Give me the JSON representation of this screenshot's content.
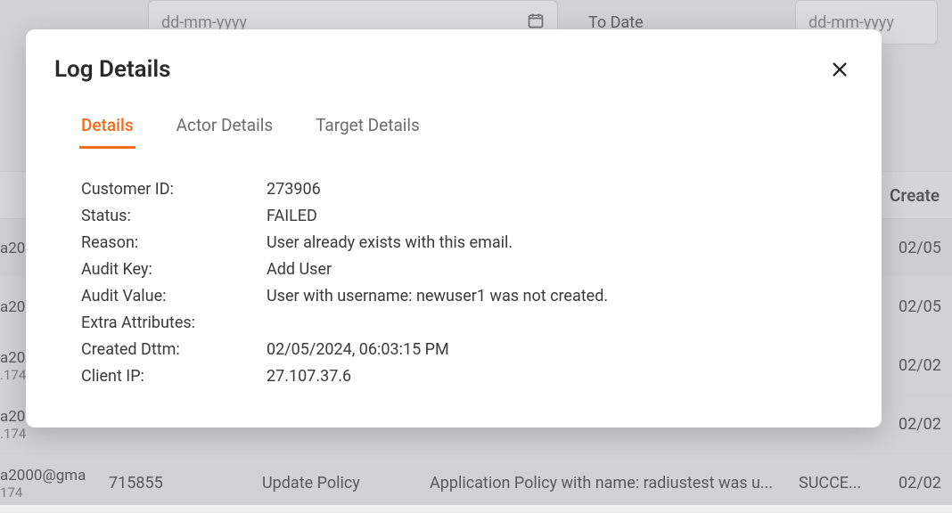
{
  "bg": {
    "from_placeholder": "dd-mm-yyyy",
    "to_label": "To Date",
    "to_placeholder": "dd-mm-yyyy",
    "header": {
      "created": "Create"
    },
    "rows": [
      {
        "email_l1": "a20",
        "email_l2": "",
        "id": "",
        "key": "",
        "val": "",
        "status": "",
        "created": "02/05"
      },
      {
        "email_l1": "a20",
        "email_l2": "",
        "id": "",
        "key": "",
        "val": "",
        "status": "",
        "created": "02/05"
      },
      {
        "email_l1": "a20",
        "email_l2": ".174",
        "id": "",
        "key": "",
        "val": "",
        "status": "",
        "created": "02/02"
      },
      {
        "email_l1": "a20",
        "email_l2": ".174",
        "id": "",
        "key": "",
        "val": "",
        "status": "",
        "created": "02/02"
      },
      {
        "email_l1": "a2000@gma",
        "email_l2": "174",
        "id": "715855",
        "key": "Update Policy",
        "val": "Application Policy with name: radiustest was u...",
        "status": "SUCCE...",
        "created": "02/02"
      }
    ]
  },
  "modal": {
    "title": "Log Details",
    "tabs": {
      "details": "Details",
      "actor": "Actor Details",
      "target": "Target Details"
    },
    "details": {
      "customer_id": {
        "label": "Customer ID:",
        "value": "273906"
      },
      "status": {
        "label": "Status:",
        "value": "FAILED"
      },
      "reason": {
        "label": "Reason:",
        "value": "User already exists with this email."
      },
      "audit_key": {
        "label": "Audit Key:",
        "value": "Add User"
      },
      "audit_value": {
        "label": "Audit Value:",
        "value": "User with username: newuser1 was not created."
      },
      "extra_attrs": {
        "label": "Extra Attributes:",
        "value": ""
      },
      "created_dttm": {
        "label": "Created Dttm:",
        "value": "02/05/2024, 06:03:15 PM"
      },
      "client_ip": {
        "label": "Client IP:",
        "value": "27.107.37.6"
      }
    }
  }
}
